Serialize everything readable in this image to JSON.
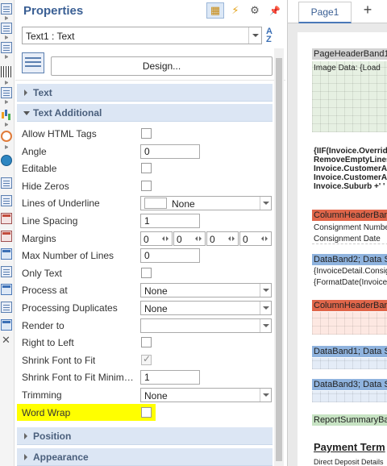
{
  "panel": {
    "title": "Properties",
    "header_buttons": [
      {
        "name": "properties-icon"
      },
      {
        "name": "events-icon"
      },
      {
        "name": "settings-icon"
      },
      {
        "name": "pin-icon"
      }
    ],
    "object_select": {
      "value": "Text1 : Text"
    },
    "sort_icon": "sort-az-icon",
    "design_button": "Design..."
  },
  "sections": {
    "text": "Text",
    "text_additional": "Text Additional",
    "position": "Position",
    "appearance": "Appearance"
  },
  "properties": [
    {
      "label": "Allow HTML Tags",
      "type": "checkbox",
      "checked": false
    },
    {
      "label": "Angle",
      "type": "text",
      "value": "0"
    },
    {
      "label": "Editable",
      "type": "checkbox",
      "checked": false
    },
    {
      "label": "Hide Zeros",
      "type": "checkbox",
      "checked": false
    },
    {
      "label": "Lines of Underline",
      "type": "dropdown-swatch",
      "value": "None"
    },
    {
      "label": "Line Spacing",
      "type": "text",
      "value": "1"
    },
    {
      "label": "Margins",
      "type": "margins",
      "values": [
        "0",
        "0",
        "0",
        "0"
      ]
    },
    {
      "label": "Max Number of Lines",
      "type": "text",
      "value": "0"
    },
    {
      "label": "Only Text",
      "type": "checkbox",
      "checked": false
    },
    {
      "label": "Process at",
      "type": "dropdown",
      "value": "None"
    },
    {
      "label": "Processing Duplicates",
      "type": "dropdown",
      "value": "None"
    },
    {
      "label": "Render to",
      "type": "dropdown",
      "value": ""
    },
    {
      "label": "Right to Left",
      "type": "checkbox",
      "checked": false
    },
    {
      "label": "Shrink Font to Fit",
      "type": "checkbox",
      "checked": true,
      "disabled": true
    },
    {
      "label": "Shrink Font to Fit Minimum ...",
      "type": "text",
      "value": "1"
    },
    {
      "label": "Trimming",
      "type": "dropdown",
      "value": "None"
    },
    {
      "label": "Word Wrap",
      "type": "checkbox",
      "checked": false,
      "highlight": true
    }
  ],
  "designer": {
    "tab": "Page1",
    "add_tab": "+",
    "bands": {
      "page_header": "PageHeaderBand1",
      "image_data": "Image Data: {Load",
      "expr_lines": [
        "{IIF(Invoice.Override",
        "RemoveEmptyLines",
        "Invoice.CustomerA",
        "Invoice.CustomerA",
        "Invoice.Suburb +' ' +"
      ],
      "column_header_2": "ColumnHeaderBan",
      "consignment_number": "Consignment Numbe",
      "consignment_date": "Consignment Date",
      "data_band_2": "DataBand2; Data S",
      "invoice_detail": "{InvoiceDetail.Consig",
      "format_date": "{FormatDate(InvoiceD",
      "column_header_1": "ColumnHeaderBan",
      "data_band_1": "DataBand1; Data S",
      "data_band_3": "DataBand3; Data S",
      "report_summary": "ReportSummaryBa",
      "payment_terms": "Payment Term",
      "direct_deposit": "Direct Deposit Details"
    }
  },
  "colors": {
    "accent": "#3a5f94",
    "section_bg": "#dce6f4",
    "highlight": "#ffff00",
    "band_red": "#e0664a",
    "band_blue": "#8fb3de",
    "band_green": "#c7e3c3"
  }
}
